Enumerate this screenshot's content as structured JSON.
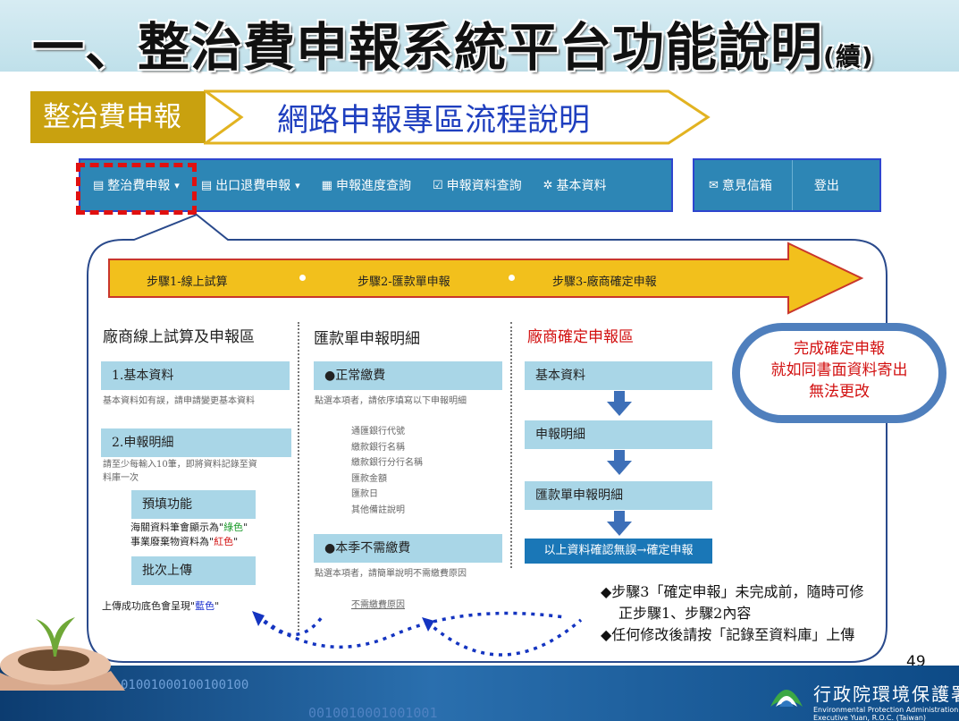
{
  "title": {
    "main": "一、整治費申報系統平台功能說明",
    "suffix": "(續)"
  },
  "section": {
    "tag": "整治費申報",
    "title": "網路申報專區流程說明"
  },
  "nav": {
    "items": [
      {
        "icon": "▤",
        "label": "整治費申報",
        "caret": "▾"
      },
      {
        "icon": "▤",
        "label": "出口退費申報",
        "caret": "▾"
      },
      {
        "icon": "▦",
        "label": "申報進度查詢"
      },
      {
        "icon": "☑",
        "label": "申報資料查詢"
      },
      {
        "icon": "✲",
        "label": "基本資料"
      }
    ],
    "right": [
      {
        "icon": "✉",
        "label": "意見信箱"
      },
      {
        "label": "登出"
      }
    ]
  },
  "steps": [
    "步驟1-線上試算",
    "步驟2-匯款單申報",
    "步驟3-廠商確定申報"
  ],
  "col1": {
    "heading": "廠商線上試算及申報區",
    "basic": "1.基本資料",
    "basic_note": "基本資料如有誤，請申請變更基本資料",
    "detail": "2.申報明細",
    "detail_note1": "請至少每輸入10筆，即將資料記錄至資",
    "detail_note2": "料庫一次",
    "prefill": "預填功能",
    "prefill_l1a": "海關資料筆會顯示為\"",
    "prefill_l1b": "綠色",
    "prefill_l1c": "\"",
    "prefill_l2a": "事業廢棄物資料為\"",
    "prefill_l2b": "紅色",
    "prefill_l2c": "\"",
    "batch": "批次上傳",
    "upload_a": "上傳成功底色會呈現\"",
    "upload_b": "藍色",
    "upload_c": "\""
  },
  "col2": {
    "heading": "匯款單申報明細",
    "normal": "●正常繳費",
    "normal_note": "點選本項者，請依序填寫以下申報明細",
    "fields": [
      "通匯銀行代號",
      "繳款銀行名稱",
      "繳款銀行分行名稱",
      "匯款金額",
      "匯款日",
      "其他備註說明"
    ],
    "nopay": "●本季不需繳費",
    "nopay_note": "點選本項者，請簡單說明不需繳費原因",
    "reason": "不需繳費原因"
  },
  "col3": {
    "heading": "廠商確定申報區",
    "b1": "基本資料",
    "b2": "申報明細",
    "b3": "匯款單申報明細",
    "final": "以上資料確認無誤→確定申報"
  },
  "oval": {
    "l1": "完成確定申報",
    "l2": "就如同書面資料寄出",
    "l3": "無法更改"
  },
  "notes": {
    "n1a": "◆步驟3「確定申報」未完成前，隨時可修",
    "n1b": "正步驟1、步驟2內容",
    "n2": "◆任何修改後請按「記錄至資料庫」上傳"
  },
  "page_number": "49",
  "footer": {
    "binary1": "01001000100100100",
    "binary2": "0010010001001001",
    "agency_zh": "行政院環境保護署",
    "agency_en1": "Environmental Protection Administration",
    "agency_en2": "Executive Yuan, R.O.C. (Taiwan)"
  },
  "colors": {
    "accent_blue": "#2d86b5",
    "gold": "#c9a10f",
    "red": "#d21010",
    "light_bar": "#a9d6e7"
  }
}
